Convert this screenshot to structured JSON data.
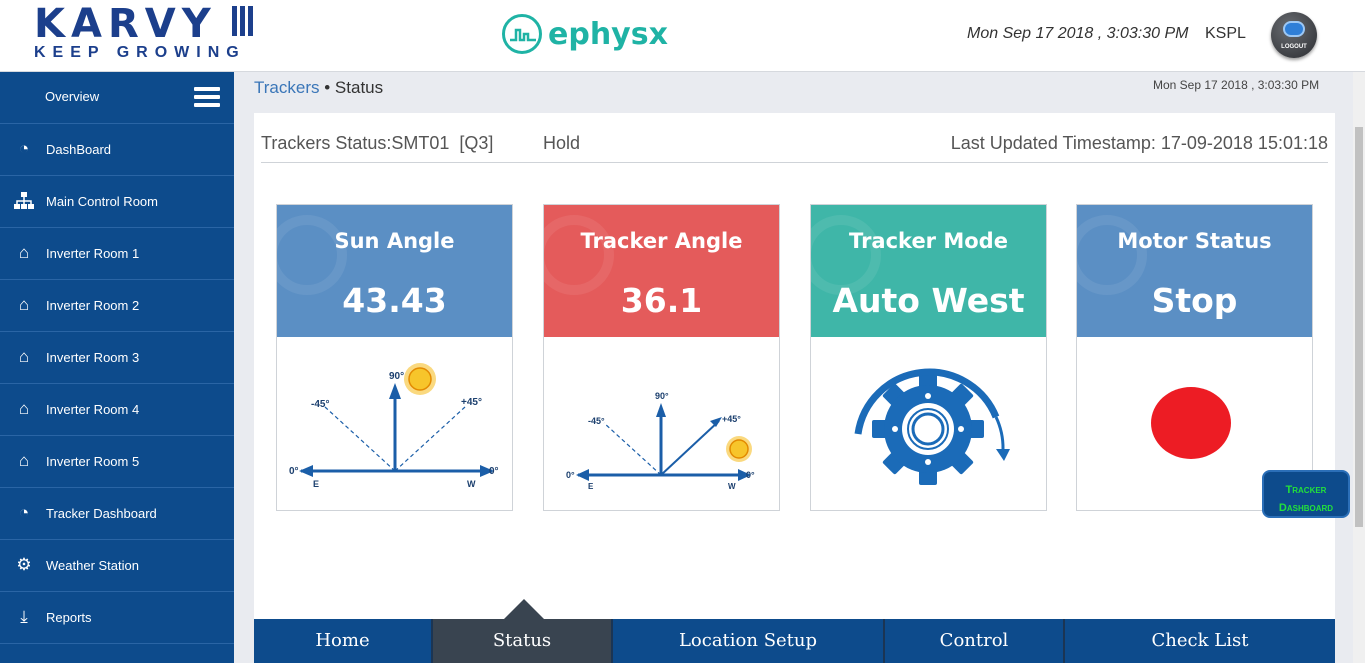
{
  "header": {
    "logo_main": "KARVY",
    "logo_tagline": "KEEP GROWING",
    "brand": "ephysx",
    "datetime": "Mon Sep 17 2018 , 3:03:30 PM",
    "user": "KSPL",
    "logout_label": "LOGOUT"
  },
  "sidebar": {
    "overview": "Overview",
    "items": [
      {
        "label": "DashBoard",
        "icon": "dashboard-icon"
      },
      {
        "label": "Main Control Room",
        "icon": "sitemap-icon"
      },
      {
        "label": "Inverter Room 1",
        "icon": "home-icon"
      },
      {
        "label": "Inverter Room 2",
        "icon": "home-icon"
      },
      {
        "label": "Inverter Room 3",
        "icon": "home-icon"
      },
      {
        "label": "Inverter Room 4",
        "icon": "home-icon"
      },
      {
        "label": "Inverter Room 5",
        "icon": "home-icon"
      },
      {
        "label": "Tracker Dashboard",
        "icon": "dashboard-icon"
      },
      {
        "label": "Weather Station",
        "icon": "gear-icon"
      },
      {
        "label": "Reports",
        "icon": "download-icon"
      }
    ]
  },
  "breadcrumb": {
    "parent": "Trackers",
    "separator": "•",
    "current": "Status",
    "datetime": "Mon Sep 17 2018 , 3:03:30 PM"
  },
  "panel": {
    "status_title": "Trackers Status:SMT01  [Q3]",
    "state": "Hold",
    "timestamp": "Last Updated Timestamp: 17-09-2018 15:01:18"
  },
  "cards": [
    {
      "title": "Sun Angle",
      "value": "43.43",
      "color": "#5b8fc4"
    },
    {
      "title": "Tracker Angle",
      "value": "36.1",
      "color": "#e45b5b"
    },
    {
      "title": "Tracker Mode",
      "value": "Auto West",
      "color": "#3fb6a8"
    },
    {
      "title": "Motor Status",
      "value": "Stop",
      "color": "#5b8fc4"
    }
  ],
  "diagram_labels": {
    "top": "90°",
    "left_diag": "-45°",
    "right_diag": "+45°",
    "left_zero": "0°",
    "right_zero": "0°",
    "east": "E",
    "west": "W"
  },
  "motor_indicator_color": "#ed1c24",
  "nav": {
    "items": [
      "Home",
      "Status",
      "Location Setup",
      "Control",
      "Check List"
    ],
    "active": "Status"
  },
  "fab_label": "Tracker Dashboard"
}
